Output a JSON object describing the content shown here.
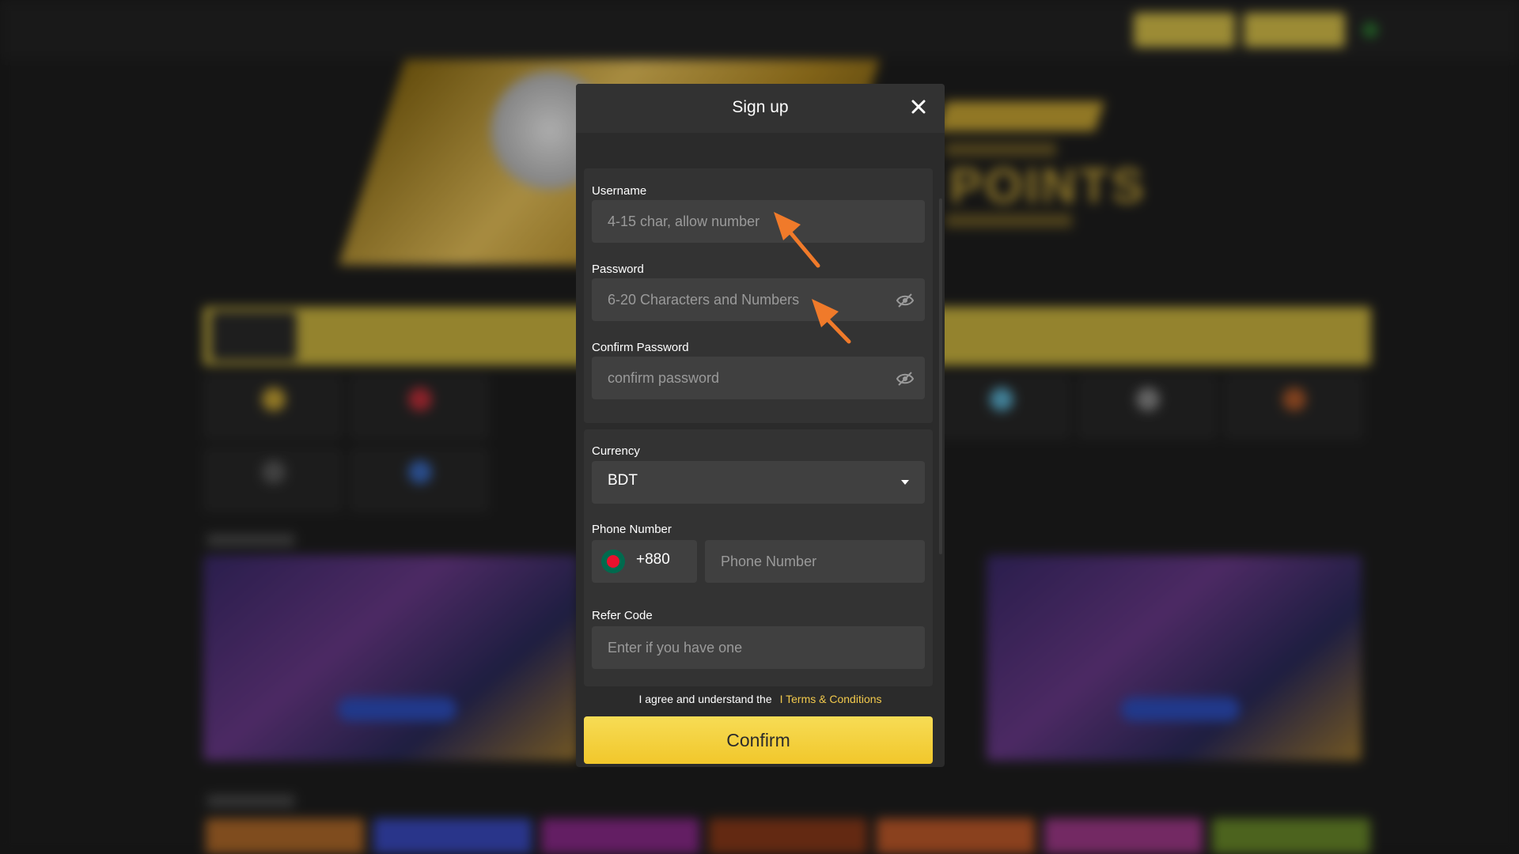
{
  "background": {
    "banner_headline": "POINTS"
  },
  "modal": {
    "title": "Sign up",
    "username": {
      "label": "Username",
      "placeholder": "4-15 char, allow number"
    },
    "password": {
      "label": "Password",
      "placeholder": "6-20 Characters and Numbers"
    },
    "confirm_password": {
      "label": "Confirm Password",
      "placeholder": "confirm password"
    },
    "currency": {
      "label": "Currency",
      "selected": "BDT"
    },
    "phone": {
      "label": "Phone Number",
      "country_code": "+880",
      "placeholder": "Phone Number"
    },
    "refer_code": {
      "label": "Refer Code",
      "placeholder": "Enter if you have one"
    },
    "agree_text": "I agree and understand the",
    "terms_link": "I Terms & Conditions",
    "confirm_label": "Confirm"
  },
  "colors": {
    "accent": "#f2c94c",
    "annotation_arrow": "#f07a2a",
    "modal_bg": "#2b2b2b",
    "input_bg": "#404040"
  },
  "icons": {
    "close": "close-icon",
    "eye": "eye-slash-icon",
    "caret": "chevron-down-icon",
    "flag": "bangladesh-flag-icon"
  }
}
